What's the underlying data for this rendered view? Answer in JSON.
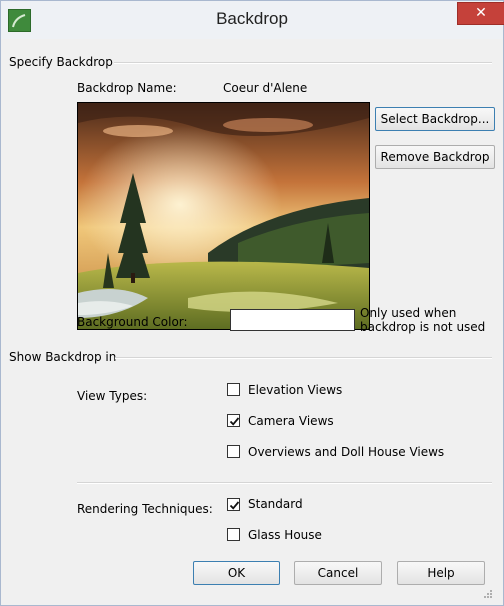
{
  "window": {
    "title": "Backdrop"
  },
  "specify": {
    "group_title": "Specify Backdrop",
    "name_label": "Backdrop Name:",
    "name_value": "Coeur d'Alene",
    "select_button": "Select Backdrop...",
    "remove_button": "Remove Backdrop",
    "bg_color_label": "Background Color:",
    "bg_color_note_line1": "Only used when",
    "bg_color_note_line2": "backdrop is not used",
    "bg_color": "#ffffff"
  },
  "show": {
    "group_title": "Show Backdrop in",
    "view_types_label": "View Types:",
    "view_types": [
      {
        "label": "Elevation Views",
        "checked": false
      },
      {
        "label": "Camera Views",
        "checked": true
      },
      {
        "label": "Overviews and Doll House Views",
        "checked": false
      }
    ],
    "rendering_label": "Rendering Techniques:",
    "rendering": [
      {
        "label": "Standard",
        "checked": true
      },
      {
        "label": "Glass House",
        "checked": false
      }
    ]
  },
  "footer": {
    "ok": "OK",
    "cancel": "Cancel",
    "help": "Help"
  },
  "colors": {
    "title_bg": "#eef1f5",
    "close_bg": "#c5413a",
    "dialog_bg": "#f0f0f0",
    "focus_border": "#3c7fb1"
  },
  "icons": {
    "app": "app-icon",
    "close": "close-icon",
    "check": "checkmark-icon"
  }
}
